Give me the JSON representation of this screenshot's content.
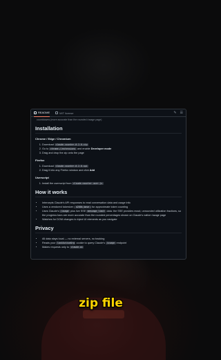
{
  "tabs": [
    {
      "label": "README",
      "icon": "book-icon"
    },
    {
      "label": "MIT license",
      "icon": "scale-icon"
    }
  ],
  "toolbar": {
    "edit_icon": "pencil-icon",
    "menu_icon": "list-icon"
  },
  "readme": {
    "intro_tail": "countdowns (more accurate than the rounded /usage page)",
    "installation": {
      "title": "Installation",
      "chrome": {
        "title": "Chrome / Edge / Chromium",
        "items": [
          {
            "pre": "Download ",
            "code": "claude-counter-0.2.0.zip",
            "post": ""
          },
          {
            "pre": "Go to ",
            "code": "chrome://extensions",
            "mid": " and enable ",
            "bold": "Developer mode"
          },
          {
            "text": "Drag and drop the zip onto the page"
          }
        ]
      },
      "firefox": {
        "title": "Firefox",
        "items": [
          {
            "pre": "Download ",
            "code": "claude-counter-0.2.0.xpi"
          },
          {
            "text": "Drag it into any Firefox window and click ",
            "bold": "Add"
          }
        ]
      },
      "userscript": {
        "title": "Userscript",
        "items": [
          {
            "pre": "Install the userscript from ",
            "code": "claude-counter.user.js"
          }
        ]
      }
    },
    "how": {
      "title": "How it works",
      "items": [
        {
          "text": "Intercepts Claude's API responses to read conversation data and usage info"
        },
        {
          "pre": "Uses a vendored tokenizer (",
          "code": "o200k_base",
          "post": ") for approximate token counting"
        },
        {
          "pre": "Uses Claude's ",
          "code": "/usage",
          "mid1": " plus live SSE ",
          "code2": "message_limit",
          "mid2": " data: the SSE provides exact, unrounded utilization fractions, so the progress bars are more accurate than the rounded percentages shown on Claude's native /usage page"
        },
        {
          "text": "Watches for DOM changes to inject UI elements as you navigate"
        }
      ]
    },
    "privacy": {
      "title": "Privacy",
      "items": [
        {
          "text": "All data stays local — no external servers, no tracking"
        },
        {
          "pre": "Reads your ",
          "code": "lastActiveOrg",
          "post": " cookie to query Claude's ",
          "code2": "/usage",
          "post2": " endpoint"
        },
        {
          "pre": "Makes requests only to ",
          "code": "claude.ai"
        }
      ]
    }
  },
  "caption": "zip file",
  "colors": {
    "caption": "#ffd400",
    "panel_bg": "#0d1117",
    "tab_accent": "#f78166"
  }
}
